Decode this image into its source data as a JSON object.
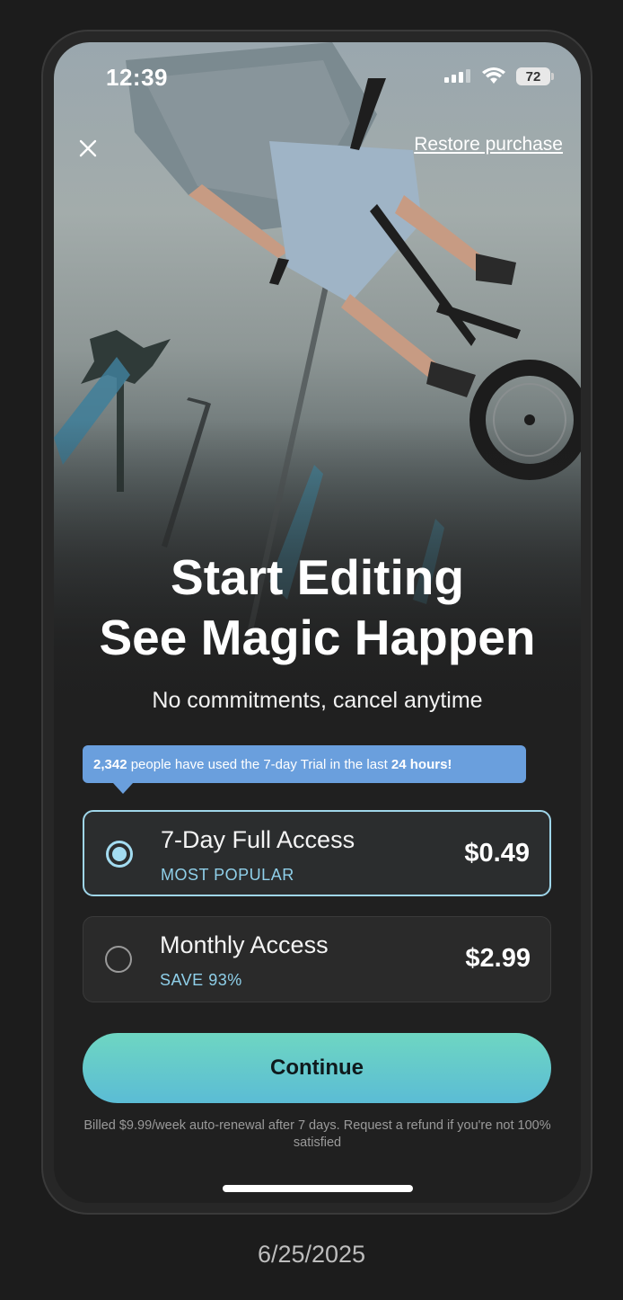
{
  "status_bar": {
    "time": "12:39",
    "battery": "72"
  },
  "header": {
    "restore_label": "Restore purchase"
  },
  "headline": {
    "line1": "Start Editing",
    "line2": "See Magic Happen"
  },
  "subheadline": "No commitments, cancel anytime",
  "banner": {
    "count": "2,342",
    "middle": " people have used the 7-day Trial in the last ",
    "period": "24 hours!"
  },
  "plans": [
    {
      "title": "7-Day Full Access",
      "tag": "MOST POPULAR",
      "price": "$0.49",
      "selected": true
    },
    {
      "title": "Monthly Access",
      "tag": "SAVE 93%",
      "price": "$2.99",
      "selected": false
    }
  ],
  "cta": {
    "label": "Continue"
  },
  "legal": "Billed $9.99/week auto-renewal after 7 days. Request a refund if you're not 100% satisfied",
  "footer_date": "6/25/2025",
  "colors": {
    "accent": "#8fd0ea",
    "banner": "#6a9fdd",
    "cta_top": "#6ed6c2",
    "cta_bottom": "#5bbcd5"
  }
}
